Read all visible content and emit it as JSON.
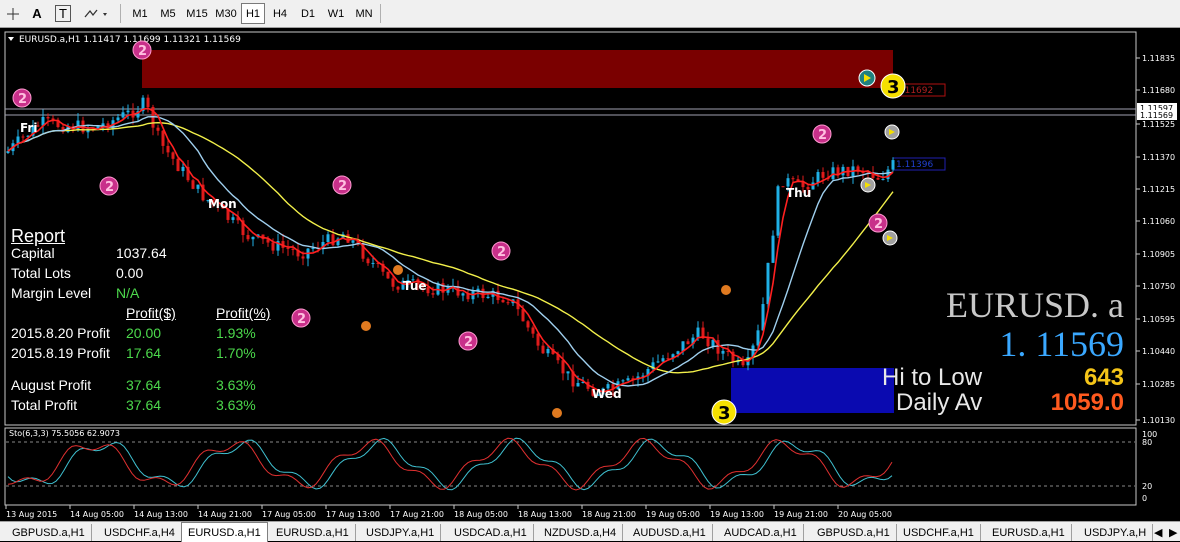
{
  "toolbar": {
    "tools": [
      "A",
      "T"
    ],
    "timeframes": [
      "M1",
      "M5",
      "M15",
      "M30",
      "H1",
      "H4",
      "D1",
      "W1",
      "MN"
    ],
    "active_timeframe": "H1"
  },
  "chart": {
    "header": "EURUSD.a,H1  1.11417 1.11699 1.11321 1.11569",
    "price_labels": [
      "1.11835",
      "1.11680",
      "1.11597",
      "1.11569",
      "1.11525",
      "1.11370",
      "1.11215",
      "1.11060",
      "1.10905",
      "1.10750",
      "1.10595",
      "1.10440",
      "1.10285",
      "1.10130"
    ],
    "ask_line_label": "1.11597",
    "bid_line_label": "1.11569",
    "box_label_red": "1.11692",
    "box_label_blue": "1.11396",
    "day_labels": [
      "Fri",
      "Mon",
      "Tue",
      "Wed",
      "Thu"
    ],
    "time_labels": [
      "13 Aug 2015",
      "14 Aug 05:00",
      "14 Aug 13:00",
      "14 Aug 21:00",
      "17 Aug 05:00",
      "17 Aug 13:00",
      "17 Aug 21:00",
      "18 Aug 05:00",
      "18 Aug 13:00",
      "18 Aug 21:00",
      "19 Aug 05:00",
      "19 Aug 13:00",
      "19 Aug 21:00",
      "20 Aug 05:00"
    ],
    "markers": {
      "two": "2",
      "three": "3"
    }
  },
  "report": {
    "title": "Report",
    "capital_label": "Capital",
    "capital_value": "1037.64",
    "lots_label": "Total Lots",
    "lots_value": "0.00",
    "margin_label": "Margin Level",
    "margin_value": "N/A",
    "col1": "Profit($)",
    "col2": "Profit(%)",
    "rows": [
      {
        "label": "2015.8.20 Profit",
        "usd": "20.00",
        "pct": "1.93%"
      },
      {
        "label": "2015.8.19 Profit",
        "usd": "17.64",
        "pct": "1.70%"
      },
      {
        "label": "August Profit",
        "usd": "37.64",
        "pct": "3.63%"
      },
      {
        "label": "Total Profit",
        "usd": "37.64",
        "pct": "3.63%"
      }
    ]
  },
  "info": {
    "symbol": "EURUSD. a",
    "price": "1. 11569",
    "hi_low_label": "Hi to Low",
    "hi_low_value": "643",
    "daily_label": "Daily Av",
    "daily_value": "1059.0"
  },
  "stochastic": {
    "header": "Sto(6,3,3) 75.5056 62.9073",
    "levels": [
      "100",
      "80",
      "20",
      "0"
    ]
  },
  "tabs": [
    "GBPUSD.a,H1",
    "USDCHF.a,H4",
    "EURUSD.a,H1",
    "EURUSD.a,H1",
    "USDJPY.a,H1",
    "USDCAD.a,H1",
    "NZDUSD.a,H4",
    "AUDUSD.a,H1",
    "AUDCAD.a,H1",
    "GBPUSD.a,H1",
    "USDCHF.a,H1",
    "EURUSD.a,H1",
    "USDJPY.a,H"
  ],
  "active_tab_index": 2,
  "colors": {
    "bull": "#1fb0e6",
    "bear": "#e01b1b",
    "ma_red": "#ff2020",
    "ma_blue": "#9fcfee",
    "ma_yellow": "#f2f04a",
    "marker_pink": "#c8308a",
    "marker_yellow": "#f5e000",
    "price_blue": "#3aa8ff",
    "hilo": "#f5c518",
    "daily": "#ff5a1f"
  }
}
